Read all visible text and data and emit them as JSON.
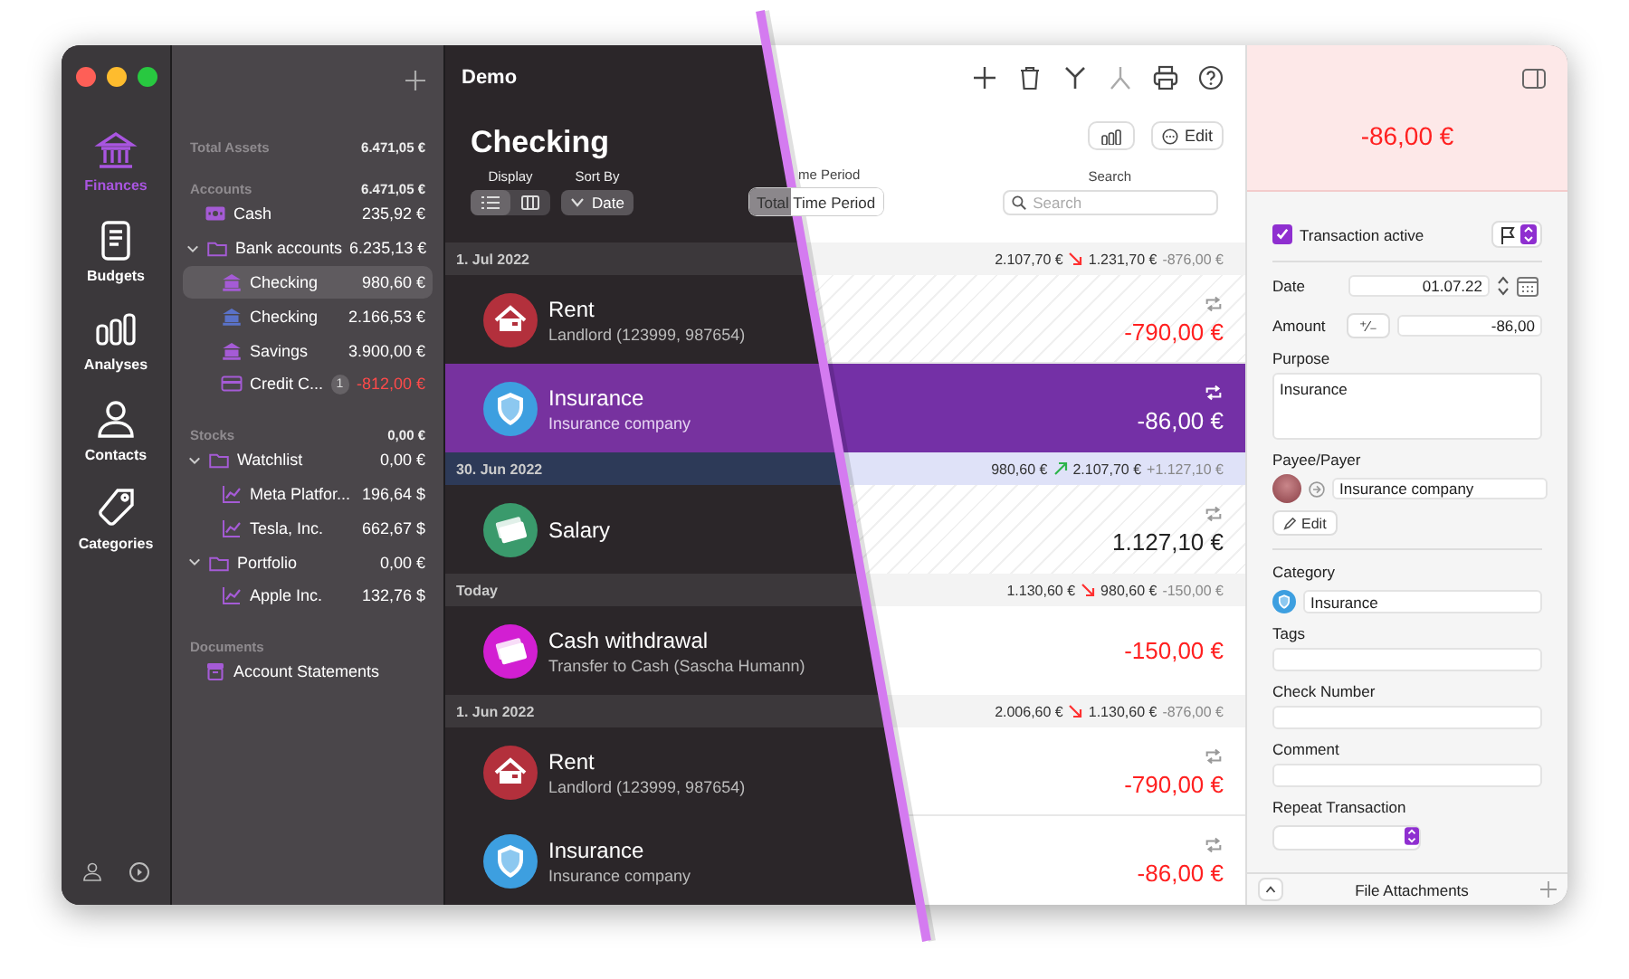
{
  "window": {
    "title": "Demo"
  },
  "nav": [
    {
      "label": "Finances",
      "kind": "bank",
      "selected": true
    },
    {
      "label": "Budgets",
      "kind": "document",
      "selected": false
    },
    {
      "label": "Analyses",
      "kind": "bars",
      "selected": false
    },
    {
      "label": "Contacts",
      "kind": "person",
      "selected": false
    },
    {
      "label": "Categories",
      "kind": "tag",
      "selected": false
    }
  ],
  "sidebar": {
    "sections": [
      {
        "title": "Total Assets",
        "total": "6.471,05 €"
      },
      {
        "title": "Accounts",
        "total": "6.471,05 €",
        "items": [
          {
            "kind": "cash",
            "name": "Cash",
            "amount": "235,92 €",
            "color": "#a55bd6",
            "selected": false
          },
          {
            "kind": "folder",
            "name": "Bank accounts",
            "amount": "6.235,13 €",
            "color": "#a55bd6",
            "selected": false,
            "expanded": true,
            "children": [
              {
                "kind": "bank",
                "name": "Checking",
                "amount": "980,60 €",
                "color": "#a55bd6",
                "selected": true
              },
              {
                "kind": "bank",
                "name": "Checking",
                "amount": "2.166,53 €",
                "color": "#5a72c8",
                "selected": false
              },
              {
                "kind": "bank",
                "name": "Savings",
                "amount": "3.900,00 €",
                "color": "#a55bd6",
                "selected": false
              },
              {
                "kind": "card",
                "name": "Credit C...",
                "badge": "1",
                "amount": "-812,00 €",
                "color": "#a55bd6",
                "selected": false,
                "negative": true
              }
            ]
          }
        ]
      },
      {
        "title": "Stocks",
        "total": "0,00 €",
        "items": [
          {
            "kind": "folder",
            "name": "Watchlist",
            "amount": "0,00 €",
            "color": "#a55bd6",
            "selected": false,
            "expanded": true,
            "children": [
              {
                "kind": "chart",
                "name": "Meta Platfor...",
                "amount": "196,64 $",
                "color": "#a55bd6",
                "selected": false
              },
              {
                "kind": "chart",
                "name": "Tesla, Inc.",
                "amount": "662,67 $",
                "color": "#a55bd6",
                "selected": false
              }
            ]
          },
          {
            "kind": "folder",
            "name": "Portfolio",
            "amount": "0,00 €",
            "color": "#a55bd6",
            "selected": false,
            "expanded": true,
            "children": [
              {
                "kind": "chart",
                "name": "Apple Inc.",
                "amount": "132,76 $",
                "color": "#a55bd6",
                "selected": false
              }
            ]
          }
        ]
      },
      {
        "title": "Documents",
        "items": [
          {
            "kind": "archive",
            "name": "Account Statements",
            "color": "#a55bd6",
            "selected": false
          }
        ]
      }
    ]
  },
  "account": {
    "title": "Checking",
    "edit_button": "Edit",
    "display": {
      "label": "Display",
      "options": [
        {
          "kind": "list",
          "selected": true
        },
        {
          "kind": "columns",
          "selected": false
        }
      ]
    },
    "sort": {
      "label": "Sort By",
      "value": "Date"
    },
    "period": {
      "label": "me Period",
      "value": "Total Time Period"
    },
    "search": {
      "label": "Search",
      "placeholder": "Search"
    }
  },
  "groups": [
    {
      "date": "1. Jul 2022",
      "from": "2.107,70 €",
      "kind": "decrease",
      "to": "1.231,70 €",
      "change": "-876,00 €",
      "highlighted": false,
      "transactions": [
        {
          "title": "Rent",
          "subtitle": "Landlord (123999, 987654)",
          "amount": "-790,00 €",
          "kind": "house",
          "color": "#b3303c",
          "recurring": true,
          "planned": true,
          "selected": false,
          "negative": true
        },
        {
          "title": "Insurance",
          "subtitle": "Insurance company",
          "amount": "-86,00 €",
          "kind": "shield",
          "color": "#3d9fe0",
          "recurring": true,
          "selected": true,
          "negative": true
        }
      ]
    },
    {
      "date": "30. Jun 2022",
      "from": "980,60 €",
      "kind": "increase",
      "to": "2.107,70 €",
      "change": "+1.127,10 €",
      "highlighted": true,
      "transactions": [
        {
          "title": "Salary",
          "amount": "1.127,10 €",
          "kind": "money",
          "color": "#3a9a6c",
          "recurring": true,
          "planned": true,
          "selected": false,
          "negative": false
        }
      ]
    },
    {
      "date": "Today",
      "from": "1.130,60 €",
      "kind": "decrease",
      "to": "980,60 €",
      "change": "-150,00 €",
      "highlighted": false,
      "transactions": [
        {
          "title": "Cash withdrawal",
          "subtitle": "Transfer to Cash (Sascha Humann)",
          "amount": "-150,00 €",
          "kind": "money",
          "color": "#d21fd2",
          "recurring": false,
          "planned": false,
          "selected": false,
          "negative": true
        }
      ]
    },
    {
      "date": "1. Jun 2022",
      "from": "2.006,60 €",
      "kind": "decrease",
      "to": "1.130,60 €",
      "change": "-876,00 €",
      "highlighted": false,
      "transactions": [
        {
          "title": "Rent",
          "subtitle": "Landlord (123999, 987654)",
          "amount": "-790,00 €",
          "kind": "house",
          "color": "#b3303c",
          "recurring": true,
          "planned": false,
          "selected": false,
          "negative": true
        },
        {
          "title": "Insurance",
          "subtitle": "Insurance company",
          "amount": "-86,00 €",
          "kind": "shield",
          "color": "#3d9fe0",
          "recurring": true,
          "planned": false,
          "selected": false,
          "negative": true
        }
      ]
    }
  ],
  "inspector": {
    "amount": "-86,00 €",
    "active": {
      "label": "Transaction active",
      "checked": true
    },
    "date": {
      "label": "Date",
      "value": "01.07.22"
    },
    "amount_field": {
      "label": "Amount",
      "sign_button": "⁺∕₋",
      "value": "-86,00"
    },
    "purpose": {
      "label": "Purpose",
      "value": "Insurance"
    },
    "payee": {
      "label": "Payee/Payer",
      "value": "Insurance company",
      "edit_button": "Edit"
    },
    "category": {
      "label": "Category",
      "value": "Insurance"
    },
    "tags": {
      "label": "Tags"
    },
    "check_number": {
      "label": "Check Number"
    },
    "comment": {
      "label": "Comment"
    },
    "repeat": {
      "label": "Repeat Transaction"
    },
    "footer": {
      "title": "File Attachments"
    }
  }
}
